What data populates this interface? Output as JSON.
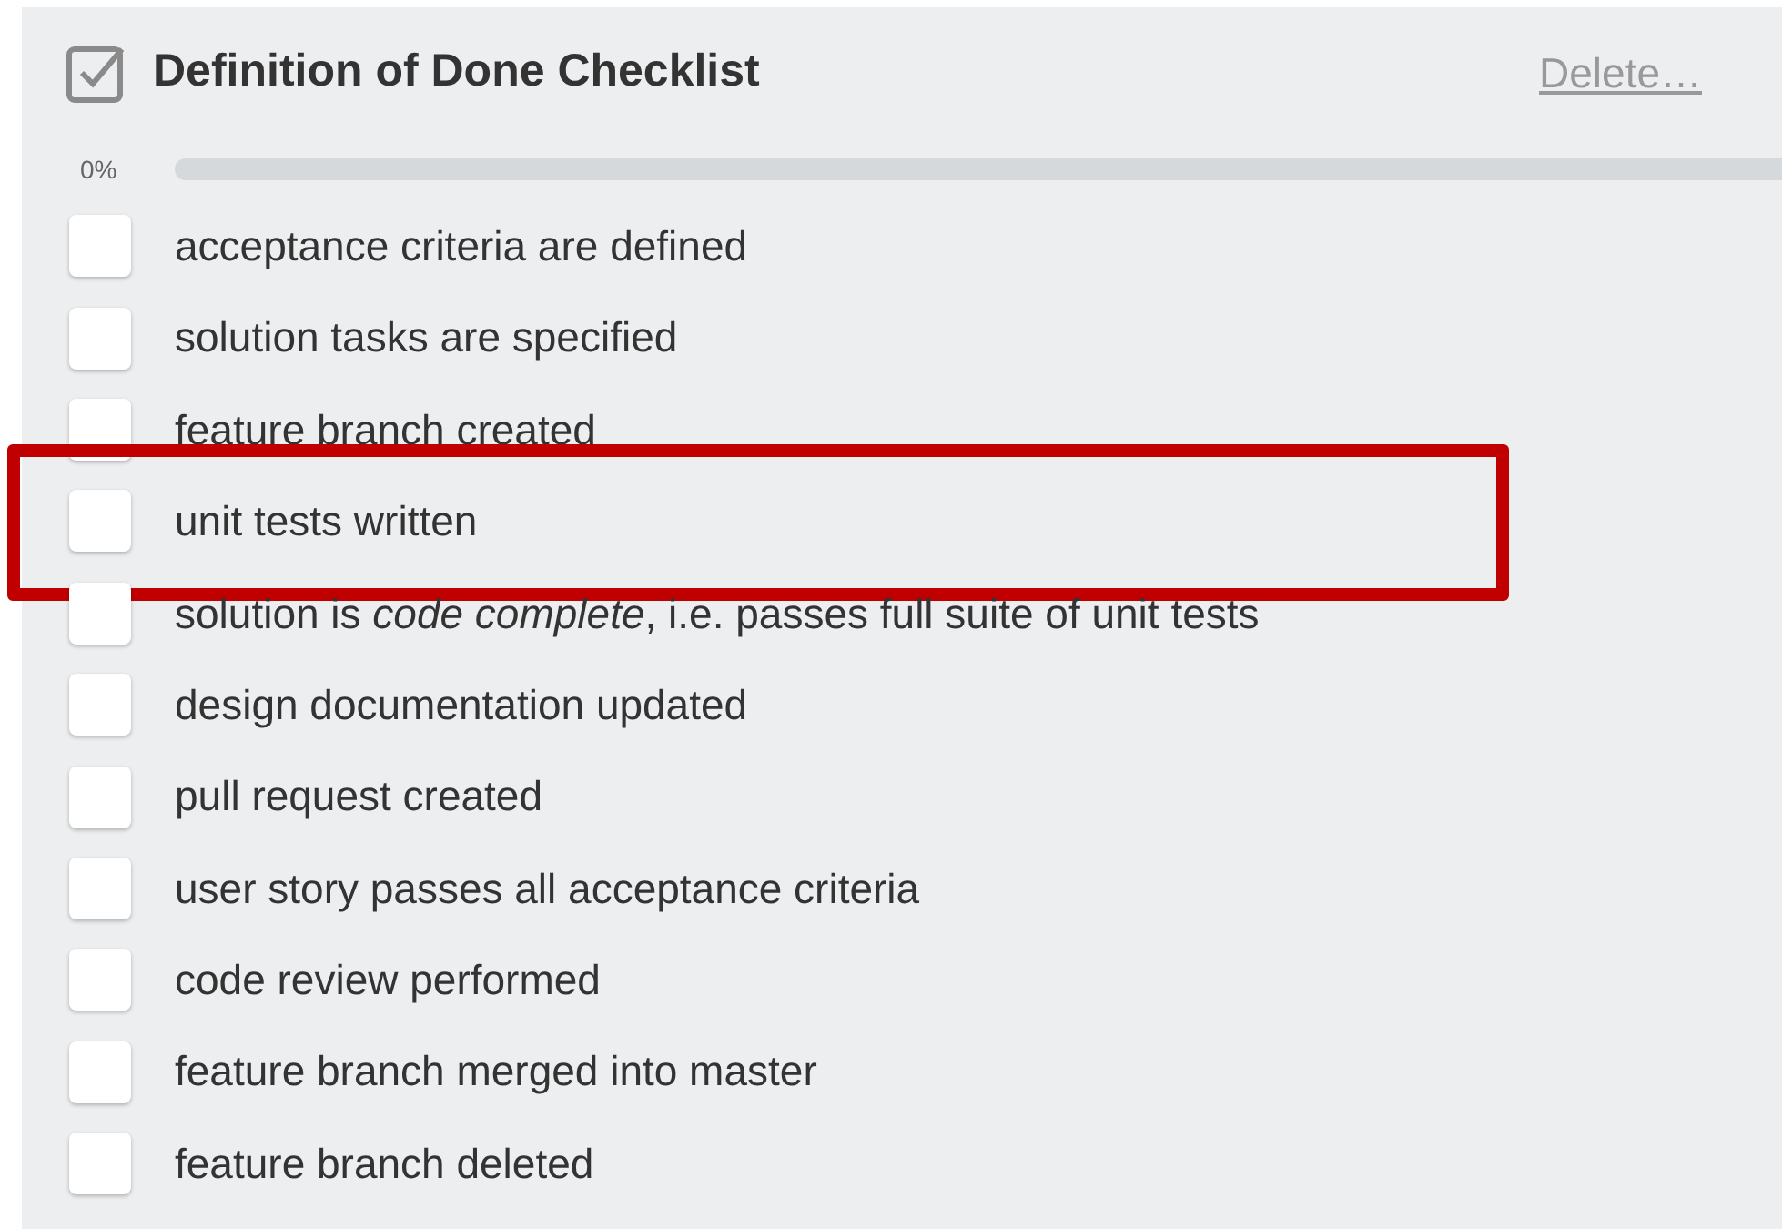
{
  "checklist": {
    "title": "Definition of Done Checklist",
    "delete_link": "Delete…",
    "progress": {
      "label": "0%",
      "level": 0
    },
    "items": [
      {
        "text": "acceptance criteria are defined",
        "checked": false,
        "highlighted": false
      },
      {
        "text": "solution tasks are specified",
        "checked": false,
        "highlighted": false
      },
      {
        "text": "feature branch created",
        "checked": false,
        "highlighted": false
      },
      {
        "text": "unit tests written",
        "checked": false,
        "highlighted": true
      },
      {
        "text": "solution is *code complete*, i.e. passes full suite of unit tests",
        "checked": false,
        "highlighted": false
      },
      {
        "text": "design documentation updated",
        "checked": false,
        "highlighted": false
      },
      {
        "text": "pull request created",
        "checked": false,
        "highlighted": false
      },
      {
        "text": "user story passes all acceptance criteria",
        "checked": false,
        "highlighted": false
      },
      {
        "text": "code review performed",
        "checked": false,
        "highlighted": false
      },
      {
        "text": "feature branch merged into master",
        "checked": false,
        "highlighted": false
      },
      {
        "text": "feature branch deleted",
        "checked": false,
        "highlighted": false
      }
    ]
  }
}
